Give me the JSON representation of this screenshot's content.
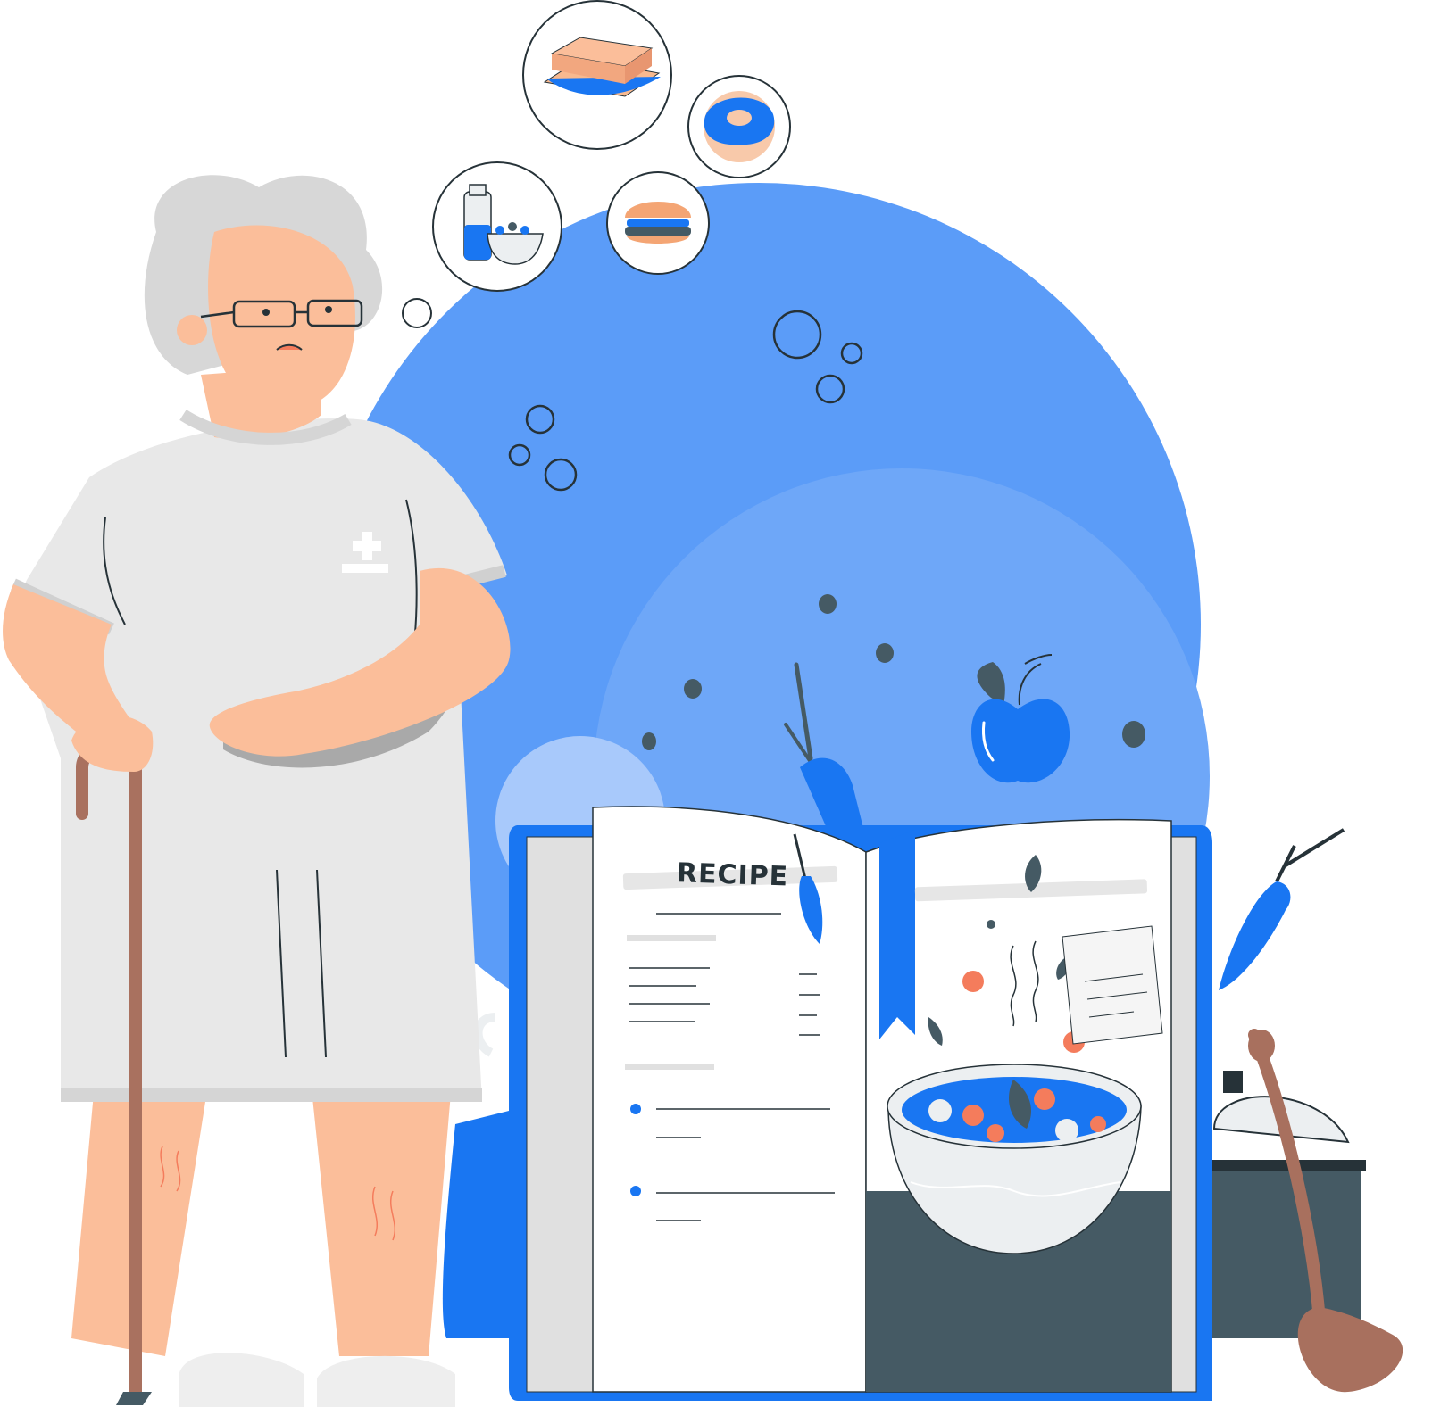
{
  "illustration": {
    "book_heading": "RECIPE"
  },
  "palette": {
    "brand_blue": "#1976F2",
    "circle_blue": "#5B9CF8",
    "circle_blue_light": "#6EA7F8",
    "dark_slate": "#455A64",
    "outline": "#263238",
    "skin": "#FBBE9A",
    "gown": "#E8E8E8",
    "hair": "#D7D7D7",
    "cane": "#A9715F",
    "ladle": "#A8705E",
    "carrot_orange": "#F47C5C"
  },
  "icons": [
    "sandwich-icon",
    "donut-icon",
    "milk-and-bowl-icon",
    "burger-icon",
    "apple-icon",
    "carrot-icon",
    "soup-bowl-icon",
    "ladle-icon",
    "cooking-pot-icon",
    "bookmark-icon",
    "notepad-icon"
  ]
}
